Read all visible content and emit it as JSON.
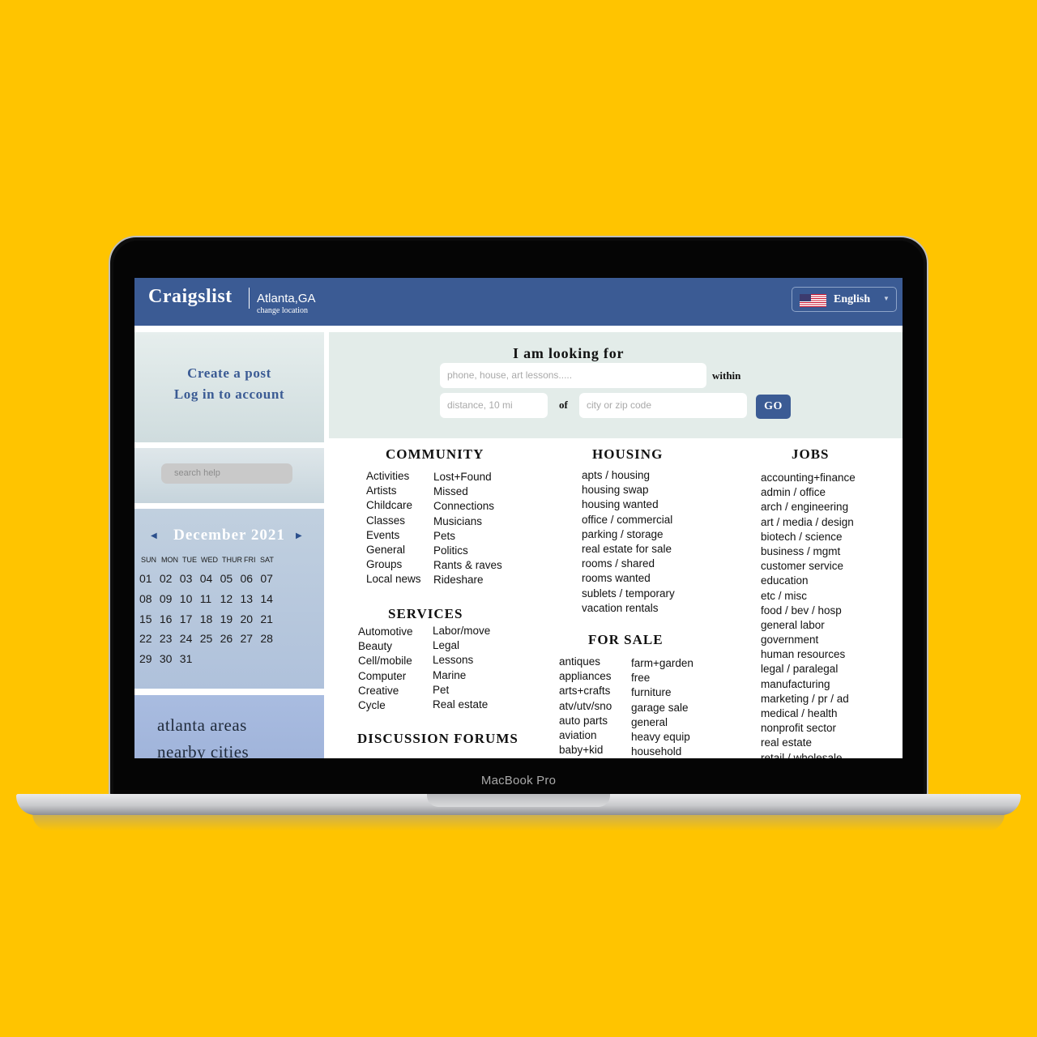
{
  "device": {
    "label": "MacBook Pro"
  },
  "header": {
    "logo": "Craigslist",
    "city": "Atlanta,GA",
    "change_location": "change location",
    "language": "English"
  },
  "sidebar": {
    "create_post": "Create a post",
    "login": "Log in to account",
    "search_help_placeholder": "search help",
    "calendar": {
      "month": "December 2021",
      "days_of_week": [
        "SUN",
        "MON",
        "TUE",
        "WED",
        "THUR",
        "FRI",
        "SAT"
      ],
      "weeks": [
        [
          "01",
          "02",
          "03",
          "04",
          "05",
          "06",
          "07"
        ],
        [
          "08",
          "09",
          "10",
          "11",
          "12",
          "13",
          "14"
        ],
        [
          "15",
          "16",
          "17",
          "18",
          "19",
          "20",
          "21"
        ],
        [
          "22",
          "23",
          "24",
          "25",
          "26",
          "27",
          "28"
        ],
        [
          "29",
          "30",
          "31"
        ]
      ]
    },
    "areas": [
      "atlanta areas",
      "nearby cities"
    ]
  },
  "search": {
    "title": "I am looking for",
    "query_placeholder": "phone, house, art lessons.....",
    "within": "within",
    "distance_placeholder": "distance, 10 mi",
    "of": "of",
    "location_placeholder": "city or zip code",
    "go": "GO"
  },
  "categories": {
    "community": {
      "title": "COMMUNITY",
      "col1": [
        "Activities",
        "Artists",
        "Childcare",
        "Classes",
        "Events",
        "General",
        "Groups",
        "Local news"
      ],
      "col2": [
        "Lost+Found",
        "Missed",
        "Connections",
        "Musicians",
        "Pets",
        "Politics",
        "Rants & raves",
        "Rideshare"
      ]
    },
    "services": {
      "title": "SERVICES",
      "col1": [
        "Automotive",
        "Beauty",
        "Cell/mobile",
        "Computer",
        "Creative",
        "Cycle"
      ],
      "col2": [
        "Labor/move",
        "Legal",
        "Lessons",
        "Marine",
        "Pet",
        "Real estate"
      ]
    },
    "discussion_forums": {
      "title": "DISCUSSION FORUMS"
    },
    "housing": {
      "title": "HOUSING",
      "items": [
        "apts / housing",
        "housing swap",
        "housing wanted",
        "office / commercial",
        "parking / storage",
        "real estate for sale",
        "rooms / shared",
        "rooms wanted",
        "sublets / temporary",
        "vacation rentals"
      ]
    },
    "for_sale": {
      "title": "FOR SALE",
      "col1": [
        "antiques",
        "appliances",
        "arts+crafts",
        "atv/utv/sno",
        "auto parts",
        "aviation",
        "baby+kid"
      ],
      "col2": [
        "farm+garden",
        "free",
        "furniture",
        "garage sale",
        "general",
        "heavy equip",
        "household"
      ]
    },
    "jobs": {
      "title": "JOBS",
      "items": [
        "accounting+finance",
        "admin / office",
        "arch / engineering",
        "art / media / design",
        "biotech / science",
        "business / mgmt",
        "customer service",
        "education",
        "etc / misc",
        "food / bev / hosp",
        "general labor",
        "government",
        "human resources",
        "legal / paralegal",
        "manufacturing",
        "marketing / pr / ad",
        "medical / health",
        "nonprofit sector",
        "real estate",
        "retail / wholesale"
      ]
    }
  }
}
